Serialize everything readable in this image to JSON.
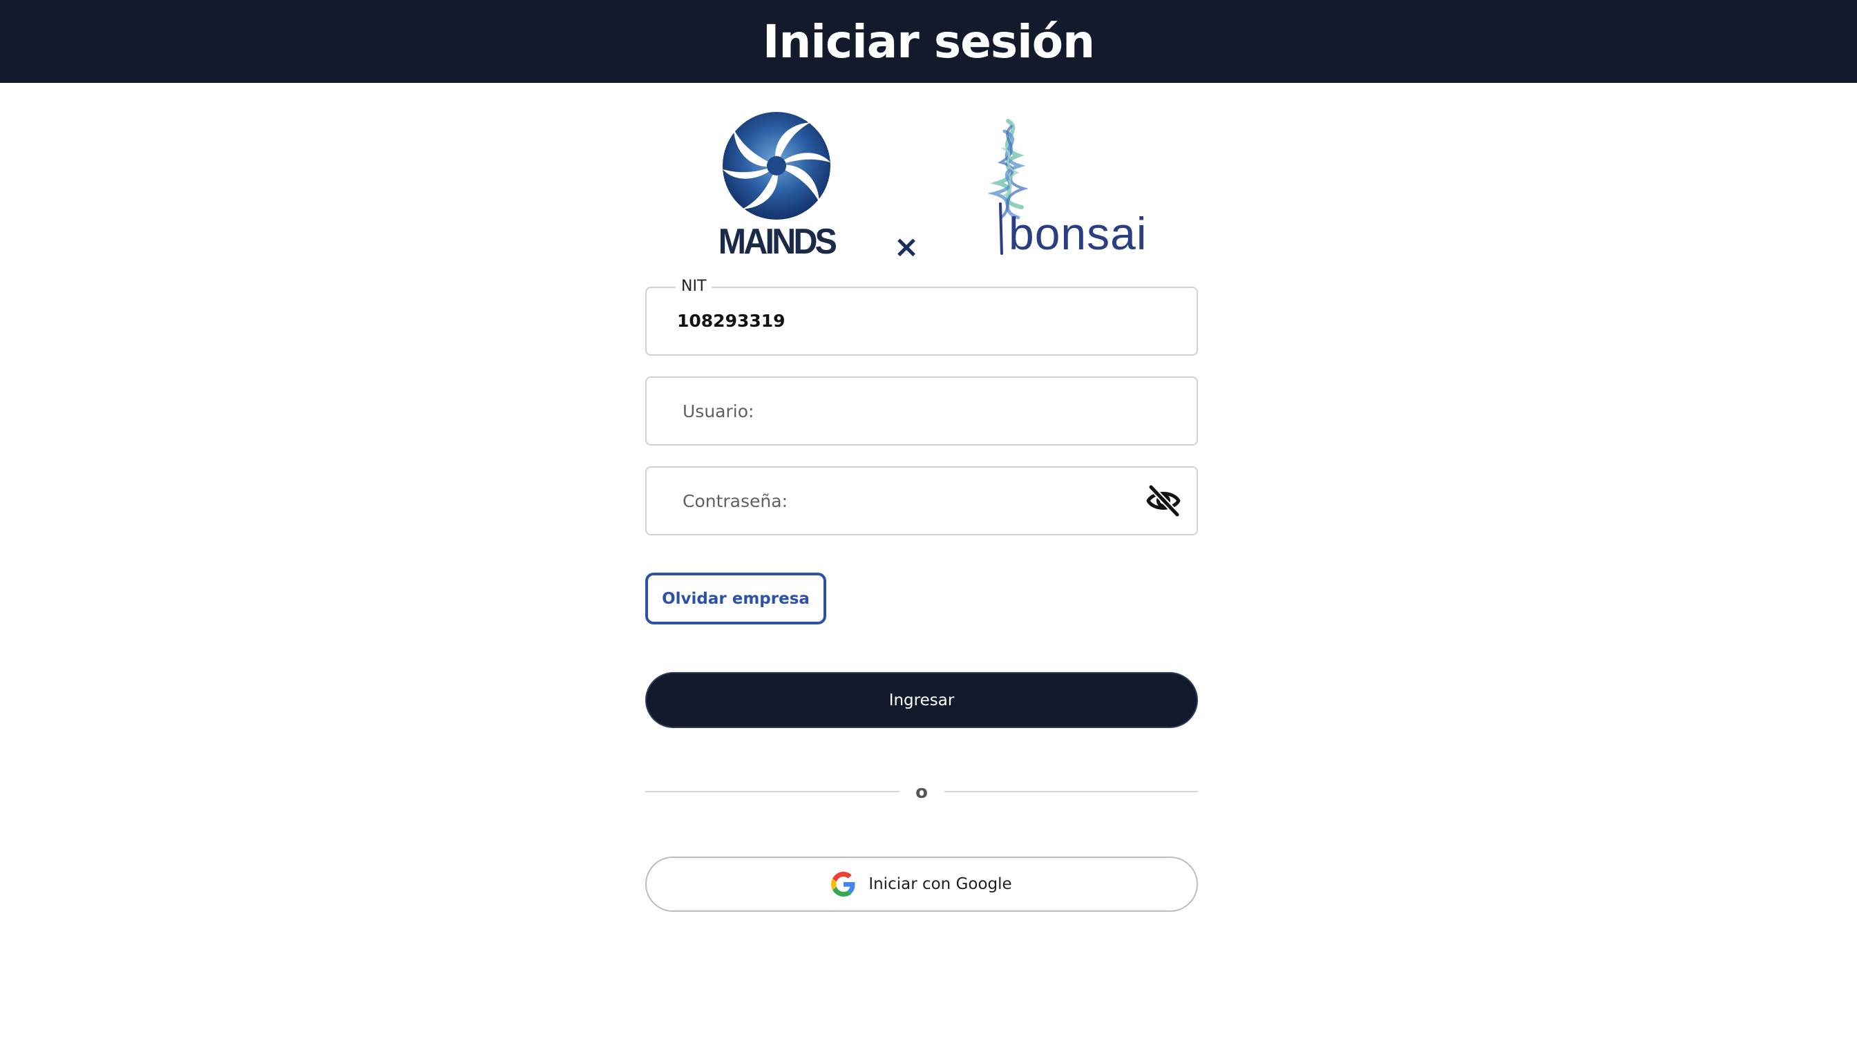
{
  "header": {
    "title": "Iniciar sesión"
  },
  "logos": {
    "left_brand": "MAINDS",
    "separator": "×",
    "right_brand": "bonsai"
  },
  "form": {
    "nit": {
      "label": "NIT",
      "value": "108293319"
    },
    "usuario": {
      "placeholder": "Usuario:"
    },
    "contrasena": {
      "placeholder": "Contraseña:",
      "toggle_icon": "eye-off-icon"
    }
  },
  "actions": {
    "olvidar_label": "Olvidar empresa",
    "ingresar_label": "Ingresar",
    "divider_text": "o",
    "google_label": "Iniciar con Google"
  },
  "colors": {
    "header_bg": "#131a2c",
    "primary_button": "#131a2c",
    "accent_blue": "#2c52a8"
  }
}
